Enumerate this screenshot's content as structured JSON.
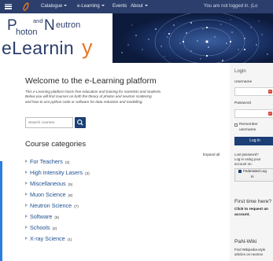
{
  "navbar": {
    "catalogue": "Catalogue",
    "elearning": "e-Learning",
    "events": "Events",
    "about": "About",
    "login_status": "You are not logged in. (Lo"
  },
  "logo": {
    "line1_big_p": "P",
    "and": "and",
    "line1_big_n": "N",
    "eutron": "eutron",
    "hoton": "hoton",
    "elearning": "eLearnin",
    "y_glyph": "y"
  },
  "main": {
    "welcome_title": "Welcome to the e-Learning platform",
    "intro_lines": [
      "This e-Learning platform hosts free education and training for scientists and students.",
      "Below you will find courses on both the theory of photon and neutron scattering",
      "and how to use python code or software for data reduction and modelling."
    ],
    "search_placeholder": "Search courses",
    "categories_title": "Course categories",
    "expand_all": "Expand all",
    "categories": [
      {
        "name": "For Teachers",
        "count": "(2)"
      },
      {
        "name": "High Intensity Lasers",
        "count": "(3)"
      },
      {
        "name": "Miscellaneous",
        "count": "(5)"
      },
      {
        "name": "Muon Science",
        "count": "(8)"
      },
      {
        "name": "Neutron Science",
        "count": "(7)"
      },
      {
        "name": "Software",
        "count": "(6)"
      },
      {
        "name": "Schools",
        "count": "(2)"
      },
      {
        "name": "X-ray Science",
        "count": "(1)"
      }
    ]
  },
  "sidebar": {
    "login_heading": "Login",
    "username_label": "Username",
    "password_label": "Password",
    "remember_line1": "Remember",
    "remember_line2": "username",
    "login_button": "Log in",
    "lost_line1": "Lost password?",
    "lost_line2": "Log in using your",
    "lost_line3": "account on:",
    "federated_line1": "Federated Log",
    "federated_line2": "in",
    "first_time_heading": "First time here?",
    "first_time_line1": "Click to request an",
    "first_time_line2": "account.",
    "wiki_heading": "PaN-Wiki",
    "wiki_line1": "Find Wikipedia-style",
    "wiki_line2": "articles on neutron"
  },
  "colors": {
    "navbar_bg": "#2c3e6b",
    "banner_dark": "#10224a",
    "accent_orange": "#e87722",
    "link_blue": "#1c4f8f",
    "button_blue": "#1b3f76",
    "sidebar_bg": "#f5f5f5"
  }
}
